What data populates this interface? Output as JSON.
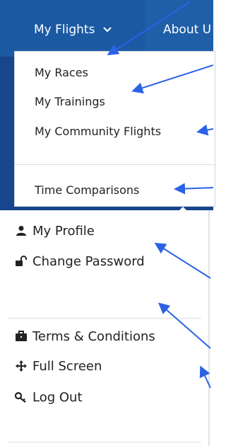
{
  "navbar": {
    "my_flights_label": "My Flights",
    "about_label": "About U"
  },
  "dropdown": {
    "items": [
      {
        "label": "My Races"
      },
      {
        "label": "My Trainings"
      },
      {
        "label": "My Community Flights"
      },
      {
        "label": "Time Comparisons"
      }
    ]
  },
  "user_menu": {
    "items": [
      {
        "label": "My Profile",
        "icon": "user-icon"
      },
      {
        "label": "Change Password",
        "icon": "unlock-icon"
      },
      {
        "label": "Terms & Conditions",
        "icon": "briefcase-icon"
      },
      {
        "label": "Full Screen",
        "icon": "move-icon"
      },
      {
        "label": "Log Out",
        "icon": "key-icon"
      }
    ]
  },
  "colors": {
    "navbar": "#1f5fa8",
    "panel_bg": "#17468c",
    "arrow": "#2b62e6"
  }
}
